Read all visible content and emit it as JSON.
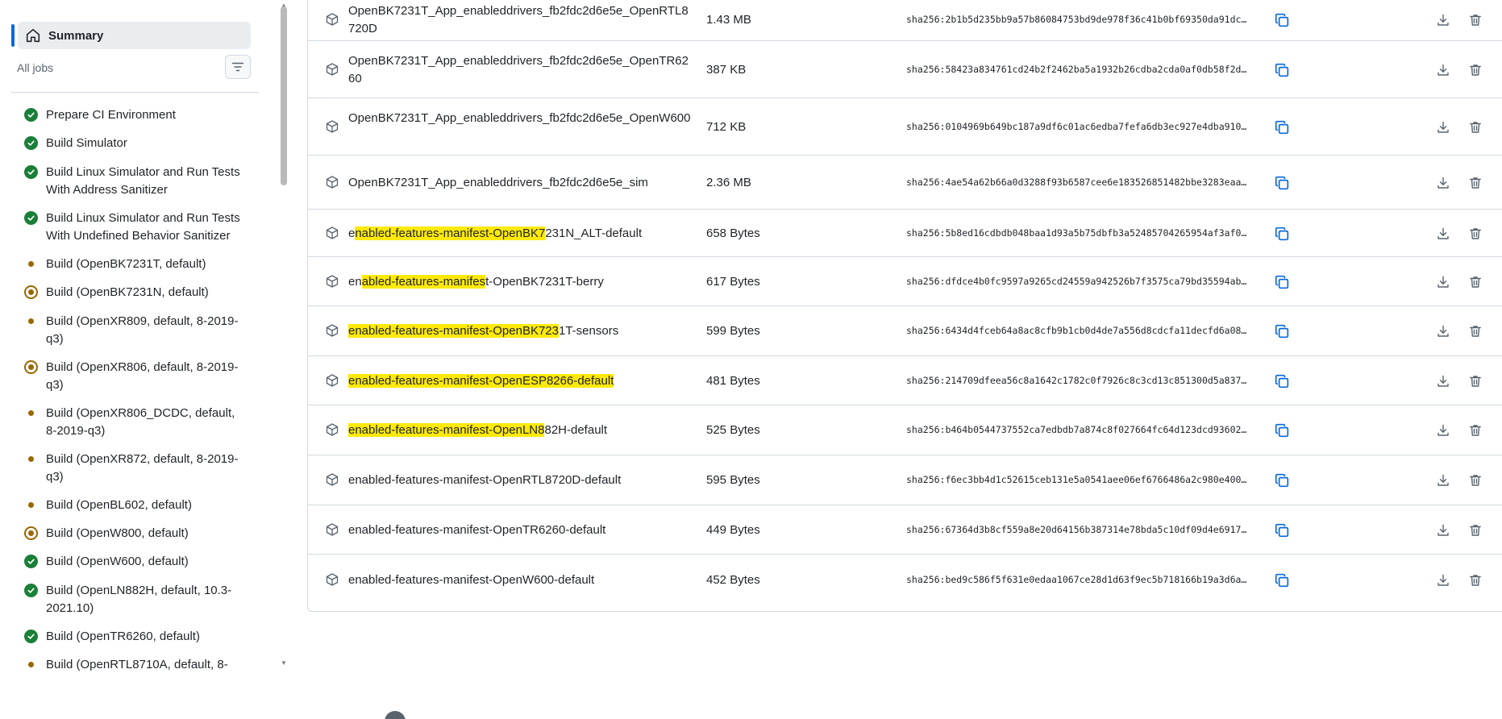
{
  "sidebar": {
    "summary_label": "Summary",
    "all_jobs_label": "All jobs",
    "jobs": [
      {
        "label": "Prepare CI Environment",
        "status": "success"
      },
      {
        "label": "Build Simulator",
        "status": "success"
      },
      {
        "label": "Build Linux Simulator and Run Tests With Address Sanitizer",
        "status": "success"
      },
      {
        "label": "Build Linux Simulator and Run Tests With Undefined Behavior Sanitizer",
        "status": "success"
      },
      {
        "label": "Build (OpenBK7231T, default)",
        "status": "queued"
      },
      {
        "label": "Build (OpenBK7231N, default)",
        "status": "in-progress"
      },
      {
        "label": "Build (OpenXR809, default, 8-2019-q3)",
        "status": "queued"
      },
      {
        "label": "Build (OpenXR806, default, 8-2019-q3)",
        "status": "in-progress"
      },
      {
        "label": "Build (OpenXR806_DCDC, default, 8-2019-q3)",
        "status": "queued"
      },
      {
        "label": "Build (OpenXR872, default, 8-2019-q3)",
        "status": "queued"
      },
      {
        "label": "Build (OpenBL602, default)",
        "status": "queued"
      },
      {
        "label": "Build (OpenW800, default)",
        "status": "in-progress"
      },
      {
        "label": "Build (OpenW600, default)",
        "status": "success"
      },
      {
        "label": "Build (OpenLN882H, default, 10.3-2021.10)",
        "status": "success"
      },
      {
        "label": "Build (OpenTR6260, default)",
        "status": "success"
      },
      {
        "label": "Build (OpenRTL8710A, default, 8-",
        "status": "queued"
      }
    ]
  },
  "artifacts": [
    {
      "name_pre": "",
      "name_hl": "",
      "name_post": "OpenBK7231T_App_enableddrivers_fb2fdc2d6e5e_OpenRTL8720D",
      "size": "1.43 MB",
      "digest": "sha256:2b1b5d235bb9a57b86084753bd9de978f36c41b0bf69350da91dc…"
    },
    {
      "name_pre": "",
      "name_hl": "",
      "name_post": "OpenBK7231T_App_enableddrivers_fb2fdc2d6e5e_OpenTR6260",
      "size": "387 KB",
      "digest": "sha256:58423a834761cd24b2f2462ba5a1932b26cdba2cda0af0db58f2d…"
    },
    {
      "name_pre": "",
      "name_hl": "",
      "name_post": "OpenBK7231T_App_enableddrivers_fb2fdc2d6e5e_OpenW600",
      "size": "712 KB",
      "digest": "sha256:0104969b649bc187a9df6c01ac6edba7fefa6db3ec927e4dba910…"
    },
    {
      "name_pre": "",
      "name_hl": "",
      "name_post": "OpenBK7231T_App_enableddrivers_fb2fdc2d6e5e_sim",
      "size": "2.36 MB",
      "digest": "sha256:4ae54a62b66a0d3288f93b6587cee6e183526851482bbe3283eaa…"
    },
    {
      "name_pre": "e",
      "name_hl": "nabled-features-manifest-OpenBK7",
      "name_post": "231N_ALT-default",
      "size": "658 Bytes",
      "digest": "sha256:5b8ed16cdbdb048baa1d93a5b75dbfb3a52485704265954af3af0…"
    },
    {
      "name_pre": "en",
      "name_hl": "abled-features-manifes",
      "name_post": "t-OpenBK7231T-berry",
      "size": "617 Bytes",
      "digest": "sha256:dfdce4b0fc9597a9265cd24559a942526b7f3575ca79bd35594ab…"
    },
    {
      "name_pre": "",
      "name_hl": "enabled-features-manifest-OpenBK723",
      "name_post": "1T-sensors",
      "size": "599 Bytes",
      "digest": "sha256:6434d4fceb64a8ac8cfb9b1cb0d4de7a556d8cdcfa11decfd6a08…"
    },
    {
      "name_pre": "",
      "name_hl": "enabled-features-manifest-OpenESP8266-default",
      "name_post": "",
      "size": "481 Bytes",
      "digest": "sha256:214709dfeea56c8a1642c1782c0f7926c8c3cd13c851300d5a837…"
    },
    {
      "name_pre": "",
      "name_hl": "enabled-features-manifest-OpenLN8",
      "name_post": "82H-default",
      "size": "525 Bytes",
      "digest": "sha256:b464b0544737552ca7edbdb7a874c8f027664fc64d123dcd93602…"
    },
    {
      "name_pre": "",
      "name_hl": "",
      "name_post": "enabled-features-manifest-OpenRTL8720D-default",
      "size": "595 Bytes",
      "digest": "sha256:f6ec3bb4d1c52615ceb131e5a0541aee06ef6766486a2c980e400…"
    },
    {
      "name_pre": "",
      "name_hl": "",
      "name_post": "enabled-features-manifest-OpenTR6260-default",
      "size": "449 Bytes",
      "digest": "sha256:67364d3b8cf559a8e20d64156b387314e78bda5c10df09d4e6917…"
    },
    {
      "name_pre": "",
      "name_hl": "",
      "name_post": "enabled-features-manifest-OpenW600-default",
      "size": "452 Bytes",
      "digest": "sha256:bed9c586f5f631e0edaa1067ce28d1d63f9ec5b718166b19a3d6a…"
    }
  ],
  "icons": {
    "package": "package-icon",
    "copy": "copy-icon",
    "download": "download-icon",
    "delete": "trash-icon",
    "home": "home-icon",
    "filter": "filter-icon"
  },
  "colors": {
    "success": "#1a7f37",
    "pending": "#9a6700",
    "highlight": "#ffe90a",
    "accent": "#0969da"
  }
}
